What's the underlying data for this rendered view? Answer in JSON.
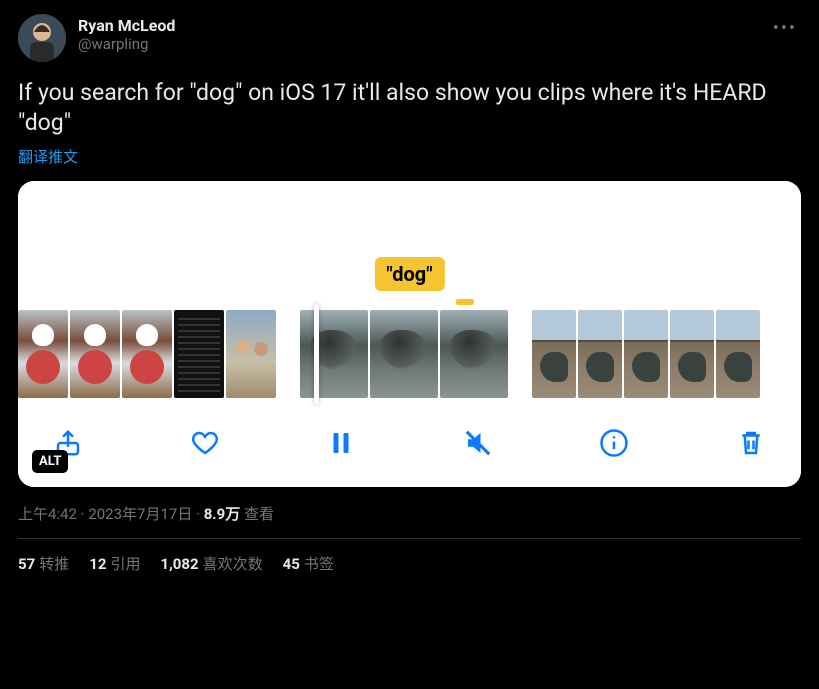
{
  "user": {
    "display_name": "Ryan McLeod",
    "handle": "@warpling"
  },
  "tweet": {
    "text": "If you search for \"dog\" on iOS 17 it'll also show you clips where it's HEARD \"dog\"",
    "translate_label": "翻译推文"
  },
  "media": {
    "caption": "\"dog\"",
    "alt_badge": "ALT",
    "toolbar": {
      "share": "share-icon",
      "like": "heart-icon",
      "pause": "pause-icon",
      "mute": "mute-icon",
      "info": "info-icon",
      "trash": "trash-icon"
    }
  },
  "meta": {
    "time": "上午4:42",
    "date": "2023年7月17日",
    "views_number": "8.9万",
    "views_label": "查看",
    "separator": " · "
  },
  "stats": {
    "retweets": {
      "count": "57",
      "label": "转推"
    },
    "quotes": {
      "count": "12",
      "label": "引用"
    },
    "likes": {
      "count": "1,082",
      "label": "喜欢次数"
    },
    "bookmarks": {
      "count": "45",
      "label": "书签"
    }
  }
}
